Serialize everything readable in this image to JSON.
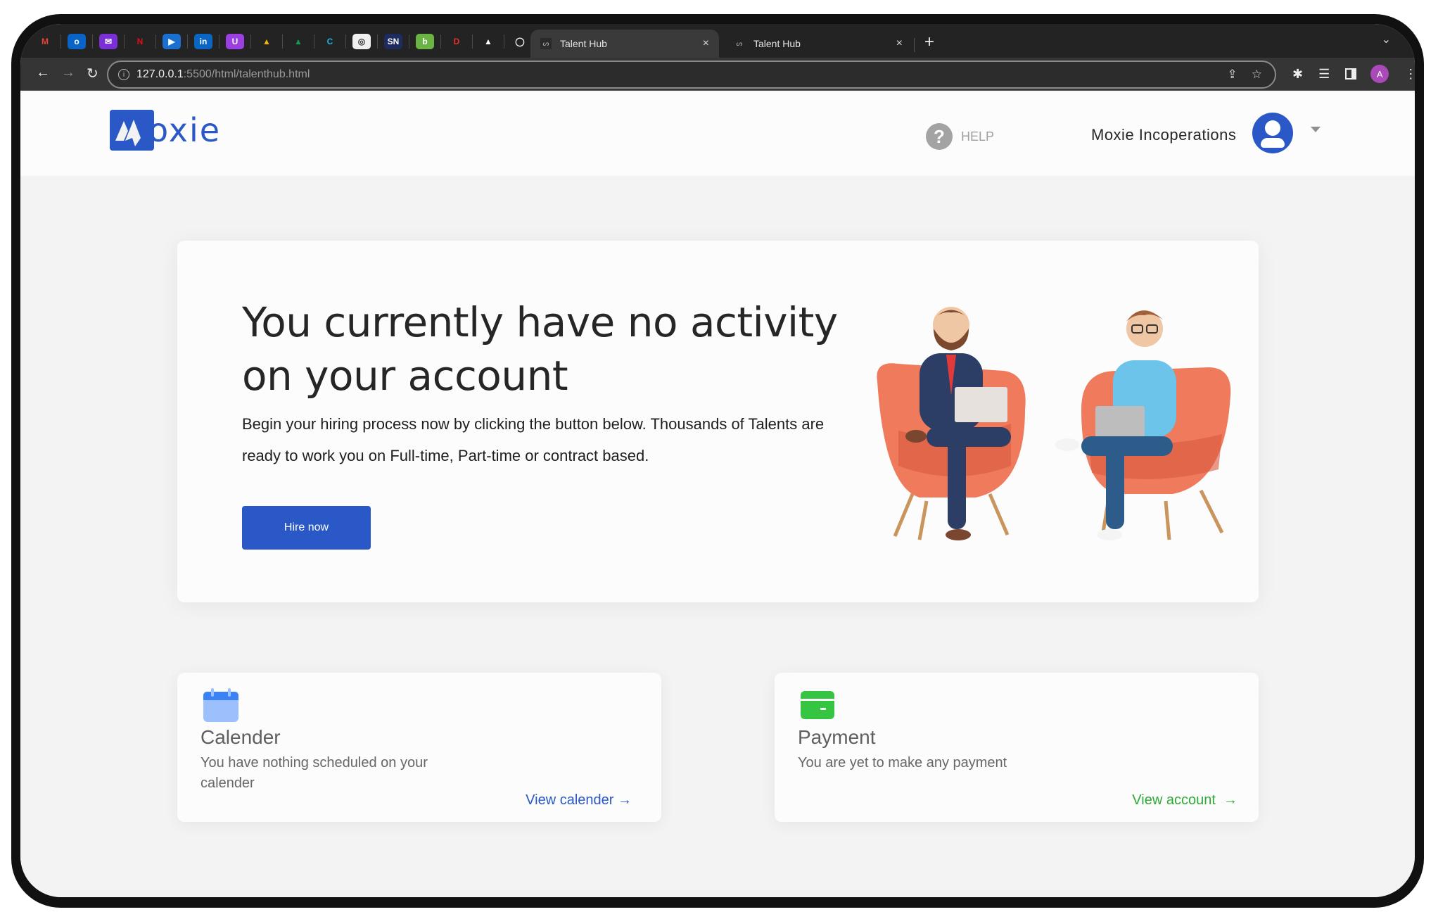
{
  "browser": {
    "bookmarks": [
      {
        "name": "gmail-icon",
        "glyph": "M",
        "color": "#ea4335",
        "bg": "transparent"
      },
      {
        "name": "outlook-icon",
        "glyph": "o",
        "color": "#ffffff",
        "bg": "#0a64c8"
      },
      {
        "name": "mail-icon",
        "glyph": "✉",
        "color": "#ffffff",
        "bg": "#7b2fd6"
      },
      {
        "name": "netflix-icon",
        "glyph": "N",
        "color": "#e50914",
        "bg": "transparent"
      },
      {
        "name": "play-icon",
        "glyph": "▶",
        "color": "#ffffff",
        "bg": "#1a6fd1"
      },
      {
        "name": "linkedin-icon",
        "glyph": "in",
        "color": "#ffffff",
        "bg": "#0a66c2"
      },
      {
        "name": "upwork-icon",
        "glyph": "U",
        "color": "#ffffff",
        "bg": "#9b3fe0"
      },
      {
        "name": "google-drive-icon",
        "glyph": "▲",
        "color": "#f4b400",
        "bg": "transparent"
      },
      {
        "name": "google-drive-icon-2",
        "glyph": "▲",
        "color": "#0f9d58",
        "bg": "transparent"
      },
      {
        "name": "c-app-icon",
        "glyph": "C",
        "color": "#1fb3e8",
        "bg": "transparent"
      },
      {
        "name": "chatgpt-icon",
        "glyph": "◎",
        "color": "#333333",
        "bg": "#f0f0f0"
      },
      {
        "name": "sn-icon",
        "glyph": "SN",
        "color": "#ffffff",
        "bg": "#1d2b5e"
      },
      {
        "name": "b-app-icon",
        "glyph": "b",
        "color": "#ffffff",
        "bg": "#6ab344"
      },
      {
        "name": "d-app-icon",
        "glyph": "D",
        "color": "#e0342b",
        "bg": "transparent"
      },
      {
        "name": "triangle-icon",
        "glyph": "▲",
        "color": "#ffffff",
        "bg": "transparent"
      },
      {
        "name": "github-icon",
        "glyph": "◯",
        "color": "#ffffff",
        "bg": "transparent"
      }
    ],
    "tabs": [
      {
        "title": "Talent Hub",
        "favicon": "ᔕ",
        "active": true
      },
      {
        "title": "Talent Hub",
        "favicon": "ᔕ",
        "active": false
      }
    ],
    "tab_close_glyph": "×",
    "new_tab_glyph": "+",
    "tab_list_glyph": "⌄",
    "nav": {
      "back": "←",
      "forward": "→",
      "reload": "↻"
    },
    "url_host": "127.0.0.1",
    "url_path": ":5500/html/talenthub.html",
    "profile_initial": "A",
    "profile_color": "#a94ab8"
  },
  "header": {
    "logo_text": "oxie",
    "help_label": "HELP",
    "help_glyph": "?",
    "account_name": "Moxie Incoperations"
  },
  "hero": {
    "title_line1": "You currently have no activity",
    "title_line2": "on your account",
    "desc_line1": "Begin your hiring process now by clicking the button below. Thousands of Talents are",
    "desc_line2": "ready to work you on Full-time, Part-time or contract based.",
    "cta_label": "Hire now"
  },
  "cards": {
    "calendar": {
      "title": "Calender",
      "desc": "You have nothing scheduled on your calender",
      "link": "View calender →",
      "link_color": "#2a58c7"
    },
    "payment": {
      "title": "Payment",
      "desc": "You are yet to make any payment",
      "link": "View account  →",
      "link_color": "#2ea836"
    }
  },
  "colors": {
    "brand_blue": "#2a58c7",
    "success_green": "#36c443",
    "calendar_blue": "#3b82f6",
    "chair_orange": "#ef7a5c"
  }
}
